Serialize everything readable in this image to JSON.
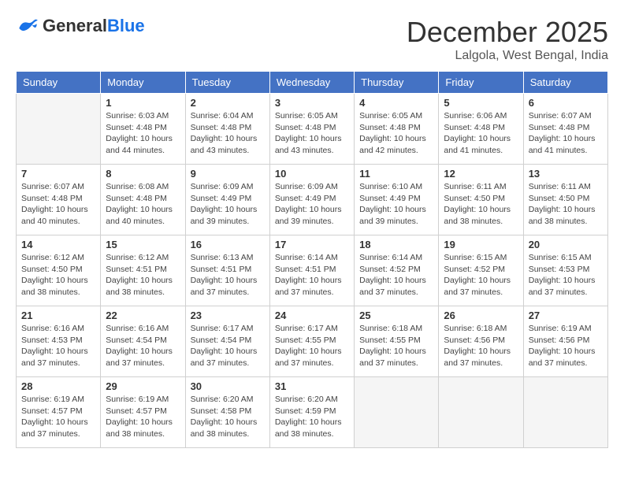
{
  "header": {
    "logo_general": "General",
    "logo_blue": "Blue",
    "month_title": "December 2025",
    "location": "Lalgola, West Bengal, India"
  },
  "days_of_week": [
    "Sunday",
    "Monday",
    "Tuesday",
    "Wednesday",
    "Thursday",
    "Friday",
    "Saturday"
  ],
  "weeks": [
    [
      {
        "day": "",
        "info": ""
      },
      {
        "day": "1",
        "info": "Sunrise: 6:03 AM\nSunset: 4:48 PM\nDaylight: 10 hours and 44 minutes."
      },
      {
        "day": "2",
        "info": "Sunrise: 6:04 AM\nSunset: 4:48 PM\nDaylight: 10 hours and 43 minutes."
      },
      {
        "day": "3",
        "info": "Sunrise: 6:05 AM\nSunset: 4:48 PM\nDaylight: 10 hours and 43 minutes."
      },
      {
        "day": "4",
        "info": "Sunrise: 6:05 AM\nSunset: 4:48 PM\nDaylight: 10 hours and 42 minutes."
      },
      {
        "day": "5",
        "info": "Sunrise: 6:06 AM\nSunset: 4:48 PM\nDaylight: 10 hours and 41 minutes."
      },
      {
        "day": "6",
        "info": "Sunrise: 6:07 AM\nSunset: 4:48 PM\nDaylight: 10 hours and 41 minutes."
      }
    ],
    [
      {
        "day": "7",
        "info": "Sunrise: 6:07 AM\nSunset: 4:48 PM\nDaylight: 10 hours and 40 minutes."
      },
      {
        "day": "8",
        "info": "Sunrise: 6:08 AM\nSunset: 4:48 PM\nDaylight: 10 hours and 40 minutes."
      },
      {
        "day": "9",
        "info": "Sunrise: 6:09 AM\nSunset: 4:49 PM\nDaylight: 10 hours and 39 minutes."
      },
      {
        "day": "10",
        "info": "Sunrise: 6:09 AM\nSunset: 4:49 PM\nDaylight: 10 hours and 39 minutes."
      },
      {
        "day": "11",
        "info": "Sunrise: 6:10 AM\nSunset: 4:49 PM\nDaylight: 10 hours and 39 minutes."
      },
      {
        "day": "12",
        "info": "Sunrise: 6:11 AM\nSunset: 4:50 PM\nDaylight: 10 hours and 38 minutes."
      },
      {
        "day": "13",
        "info": "Sunrise: 6:11 AM\nSunset: 4:50 PM\nDaylight: 10 hours and 38 minutes."
      }
    ],
    [
      {
        "day": "14",
        "info": "Sunrise: 6:12 AM\nSunset: 4:50 PM\nDaylight: 10 hours and 38 minutes."
      },
      {
        "day": "15",
        "info": "Sunrise: 6:12 AM\nSunset: 4:51 PM\nDaylight: 10 hours and 38 minutes."
      },
      {
        "day": "16",
        "info": "Sunrise: 6:13 AM\nSunset: 4:51 PM\nDaylight: 10 hours and 37 minutes."
      },
      {
        "day": "17",
        "info": "Sunrise: 6:14 AM\nSunset: 4:51 PM\nDaylight: 10 hours and 37 minutes."
      },
      {
        "day": "18",
        "info": "Sunrise: 6:14 AM\nSunset: 4:52 PM\nDaylight: 10 hours and 37 minutes."
      },
      {
        "day": "19",
        "info": "Sunrise: 6:15 AM\nSunset: 4:52 PM\nDaylight: 10 hours and 37 minutes."
      },
      {
        "day": "20",
        "info": "Sunrise: 6:15 AM\nSunset: 4:53 PM\nDaylight: 10 hours and 37 minutes."
      }
    ],
    [
      {
        "day": "21",
        "info": "Sunrise: 6:16 AM\nSunset: 4:53 PM\nDaylight: 10 hours and 37 minutes."
      },
      {
        "day": "22",
        "info": "Sunrise: 6:16 AM\nSunset: 4:54 PM\nDaylight: 10 hours and 37 minutes."
      },
      {
        "day": "23",
        "info": "Sunrise: 6:17 AM\nSunset: 4:54 PM\nDaylight: 10 hours and 37 minutes."
      },
      {
        "day": "24",
        "info": "Sunrise: 6:17 AM\nSunset: 4:55 PM\nDaylight: 10 hours and 37 minutes."
      },
      {
        "day": "25",
        "info": "Sunrise: 6:18 AM\nSunset: 4:55 PM\nDaylight: 10 hours and 37 minutes."
      },
      {
        "day": "26",
        "info": "Sunrise: 6:18 AM\nSunset: 4:56 PM\nDaylight: 10 hours and 37 minutes."
      },
      {
        "day": "27",
        "info": "Sunrise: 6:19 AM\nSunset: 4:56 PM\nDaylight: 10 hours and 37 minutes."
      }
    ],
    [
      {
        "day": "28",
        "info": "Sunrise: 6:19 AM\nSunset: 4:57 PM\nDaylight: 10 hours and 37 minutes."
      },
      {
        "day": "29",
        "info": "Sunrise: 6:19 AM\nSunset: 4:57 PM\nDaylight: 10 hours and 38 minutes."
      },
      {
        "day": "30",
        "info": "Sunrise: 6:20 AM\nSunset: 4:58 PM\nDaylight: 10 hours and 38 minutes."
      },
      {
        "day": "31",
        "info": "Sunrise: 6:20 AM\nSunset: 4:59 PM\nDaylight: 10 hours and 38 minutes."
      },
      {
        "day": "",
        "info": ""
      },
      {
        "day": "",
        "info": ""
      },
      {
        "day": "",
        "info": ""
      }
    ]
  ]
}
